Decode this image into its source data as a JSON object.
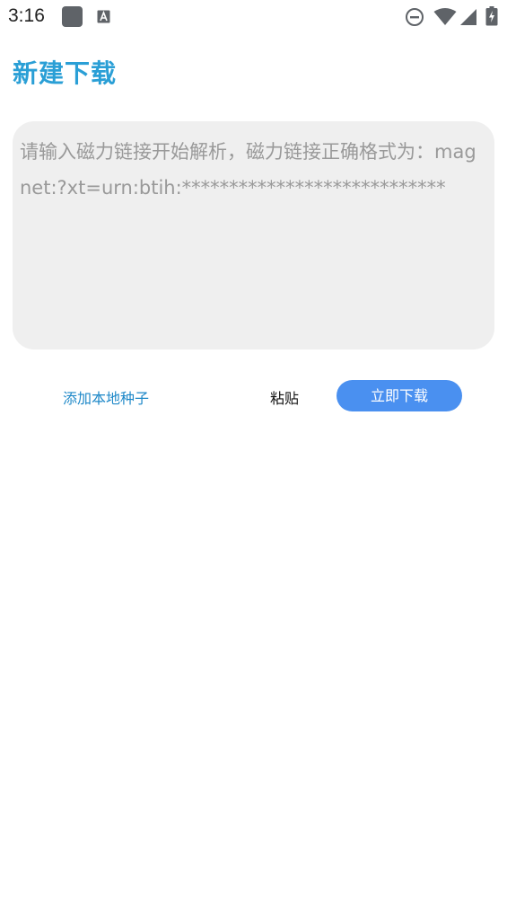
{
  "status_bar": {
    "time": "3:16",
    "icons": [
      "app-icon",
      "font-icon",
      "do-not-disturb-icon",
      "wifi-icon",
      "signal-icon",
      "battery-charging-icon"
    ]
  },
  "page": {
    "title": "新建下载"
  },
  "magnet_input": {
    "value": "",
    "placeholder": "请输入磁力链接开始解析，磁力链接正确格式为：magnet:?xt=urn:btih:****************************"
  },
  "actions": {
    "add_local_torrent": "添加本地种子",
    "paste": "粘贴",
    "download_now": "立即下载"
  },
  "colors": {
    "title": "#2a9fd6",
    "link": "#1e88c8",
    "primary_button": "#4a90f0",
    "input_background": "#efefef",
    "placeholder": "#999999"
  }
}
